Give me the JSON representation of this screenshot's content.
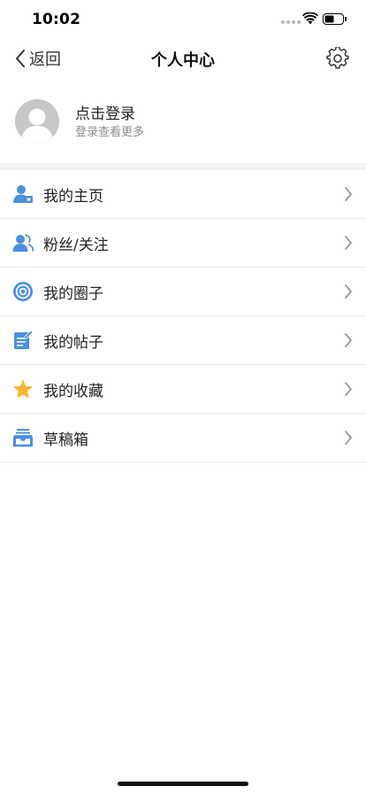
{
  "status_bar": {
    "time": "10:02"
  },
  "nav": {
    "back_label": "返回",
    "title": "个人中心"
  },
  "profile": {
    "login_title": "点击登录",
    "login_subtitle": "登录查看更多"
  },
  "menu": {
    "items": [
      {
        "label": "我的主页",
        "icon": "user-homepage-icon"
      },
      {
        "label": "粉丝/关注",
        "icon": "fans-follow-icon"
      },
      {
        "label": "我的圈子",
        "icon": "circle-target-icon"
      },
      {
        "label": "我的帖子",
        "icon": "post-edit-icon"
      },
      {
        "label": "我的收藏",
        "icon": "star-icon"
      },
      {
        "label": "草稿箱",
        "icon": "drafts-tray-icon"
      }
    ]
  },
  "colors": {
    "accent_blue": "#4a90e2",
    "star_yellow": "#f5b82e",
    "divider": "#f4f4f4"
  }
}
